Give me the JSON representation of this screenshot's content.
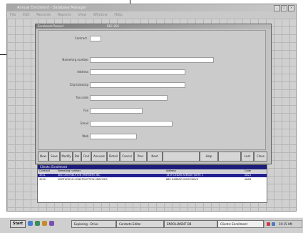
{
  "app": {
    "title": "Annual Enrolment - Database Manager",
    "menu": [
      "File",
      "Edit",
      "Records",
      "Reports",
      "View",
      "Window",
      "Help"
    ],
    "window_buttons": [
      "_",
      "□",
      "×"
    ]
  },
  "form": {
    "title": "Enrolment Record",
    "title_id": "REC-001",
    "fields": [
      {
        "label": "Contract",
        "value": ""
      },
      {
        "label": "Name/org number",
        "value": ""
      },
      {
        "label": "Address",
        "value": ""
      },
      {
        "label": "City/state/zip",
        "value": ""
      },
      {
        "label": "Tax code",
        "value": ""
      },
      {
        "label": "Fax",
        "value": ""
      },
      {
        "label": "Email",
        "value": ""
      },
      {
        "label": "Web",
        "value": ""
      }
    ],
    "buttons": [
      "New",
      "Save",
      "Modify",
      "Del",
      "Find",
      "Annuals",
      "Detail",
      "Cancel",
      "Prev",
      "Next",
      "",
      "Help",
      "",
      "Last",
      "Close"
    ]
  },
  "list": {
    "title": "Clients: Enrollment",
    "columns": [
      "Contract",
      "Name/org number",
      "Address",
      "Code"
    ],
    "rows": [
      {
        "cells": [
          "4921",
          "ABC DISTRIBUTION PARTNERS INC",
          "1435 CEDAR AVENUE SUITE 2",
          "AB21"
        ],
        "selected": true
      },
      {
        "cells": [
          "4930",
          "NORTHFIELD CONSTRUCTION SERVICES",
          "880 HARBOR VIEW DRIVE",
          "AB28"
        ],
        "selected": false
      }
    ]
  },
  "taskbar": {
    "start_label": "Start",
    "tasks": [
      "Exploring - Drive",
      "Contacts Editor",
      "ENROLLMENT DB",
      "Clients: Enrollment"
    ],
    "active_task_index": 3,
    "clock": "10:15 AM"
  },
  "colors": {
    "selection": "#23208f",
    "list_title": "#1c1d7a"
  }
}
